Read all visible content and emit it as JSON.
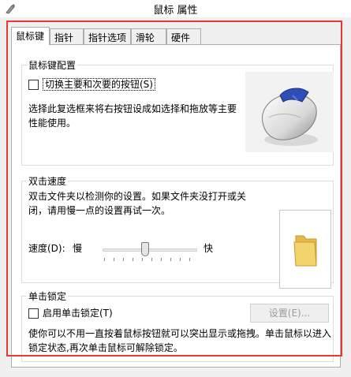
{
  "window": {
    "title": "鼠标 属性"
  },
  "tabs": [
    {
      "label": "鼠标键",
      "active": true
    },
    {
      "label": "指针",
      "active": false
    },
    {
      "label": "指针选项",
      "active": false
    },
    {
      "label": "滑轮",
      "active": false
    },
    {
      "label": "硬件",
      "active": false
    }
  ],
  "button_config": {
    "title": "鼠标键配置",
    "checkbox_label": "切换主要和次要的按钮(S)",
    "checked": false,
    "description": "选择此复选框来将右按钮设成如选择和拖放等主要性能使用。"
  },
  "double_click": {
    "title": "双击速度",
    "description": "双击文件夹以检测你的设置。如果文件夹没打开或关闭，请用慢一点的设置再试一次。",
    "speed_label": "速度(D):",
    "slow_label": "慢",
    "fast_label": "快",
    "speed_value": 0.45
  },
  "click_lock": {
    "title": "单击锁定",
    "checkbox_label": "启用单击锁定(T)",
    "checked": false,
    "settings_button": "设置(E)...",
    "description": "使你可以不用一直按着鼠标按钮就可以突出显示或拖拽。单击鼠标以进入锁定状态,再次单击鼠标可解除锁定。"
  },
  "colors": {
    "highlight_frame": "#e53935",
    "folder": "#f3d36b"
  },
  "icons": [
    "mouse-app-icon",
    "mouse-illustration",
    "folder-icon"
  ]
}
